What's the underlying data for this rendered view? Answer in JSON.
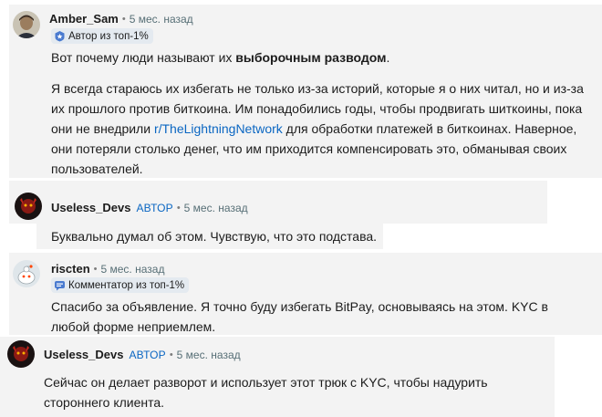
{
  "comments": [
    {
      "author": "Amber_Sam",
      "age": "5 мес. назад",
      "badge": "Автор из топ-1%",
      "paragraph1_pre": "Вот почему люди называют их ",
      "paragraph1_bold": "выборочным разводом",
      "paragraph1_post": ".",
      "paragraph2_pre": "Я всегда стараюсь их избегать не только из-за историй, которые я о них читал, но и из-за их прошлого против биткоина. Им понадобились годы, чтобы продвигать шиткоины, пока они не внедрили ",
      "paragraph2_link": "r/TheLightningNetwork",
      "paragraph2_post": " для обработки платежей в биткоинах. Наверное, они потеряли столько денег, что им приходится компенсировать это, обманывая своих пользователей."
    },
    {
      "author": "Useless_Devs",
      "op_label": "АВТОР",
      "age": "5 мес. назад",
      "body": "Буквально думал об этом. Чувствую, что это подстава."
    },
    {
      "author": "riscten",
      "age": "5 мес. назад",
      "badge": "Комментатор из топ-1%",
      "body": "Спасибо за объявление. Я точно буду избегать BitPay, основываясь на этом. KYC в любой форме неприемлем."
    },
    {
      "author": "Useless_Devs",
      "op_label": "АВТОР",
      "age": "5 мес. назад",
      "body": "Сейчас он делает разворот и использует этот трюк с KYC, чтобы надурить стороннего клиента."
    }
  ],
  "separator": "•",
  "colors": {
    "op": "#0a66c2",
    "link": "#0a66c2",
    "badge_bg": "#e4eaf0",
    "block_bg": "#f3f3f3"
  },
  "icons": {
    "badge_1": "top-author-badge-icon",
    "badge_3": "top-commenter-badge-icon"
  }
}
